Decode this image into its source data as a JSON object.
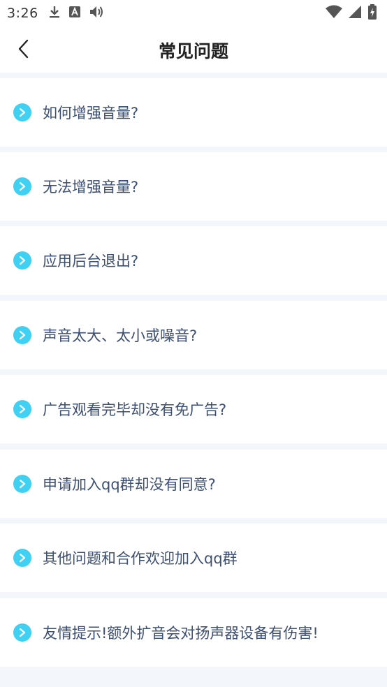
{
  "status_bar": {
    "time": "3:26",
    "left_icons": [
      "download-icon",
      "a-box-icon",
      "volume-icon"
    ],
    "right_icons": [
      "wifi-icon",
      "signal-icon",
      "battery-charging-icon"
    ]
  },
  "header": {
    "back_icon": "chevron-left-icon",
    "title": "常见问题"
  },
  "colors": {
    "icon_accent": "#3fd1f3",
    "label_text": "#3d4f72",
    "divider_bg": "#f3f6fb"
  },
  "faq": {
    "items": [
      {
        "label": "如何增强音量?"
      },
      {
        "label": "无法增强音量?"
      },
      {
        "label": "应用后台退出?"
      },
      {
        "label": "声音太大、太小或噪音?"
      },
      {
        "label": "广告观看完毕却没有免广告?"
      },
      {
        "label": "申请加入qq群却没有同意?"
      },
      {
        "label": "其他问题和合作欢迎加入qq群"
      },
      {
        "label": "友情提示!额外扩音会对扬声器设备有伤害!"
      }
    ]
  }
}
